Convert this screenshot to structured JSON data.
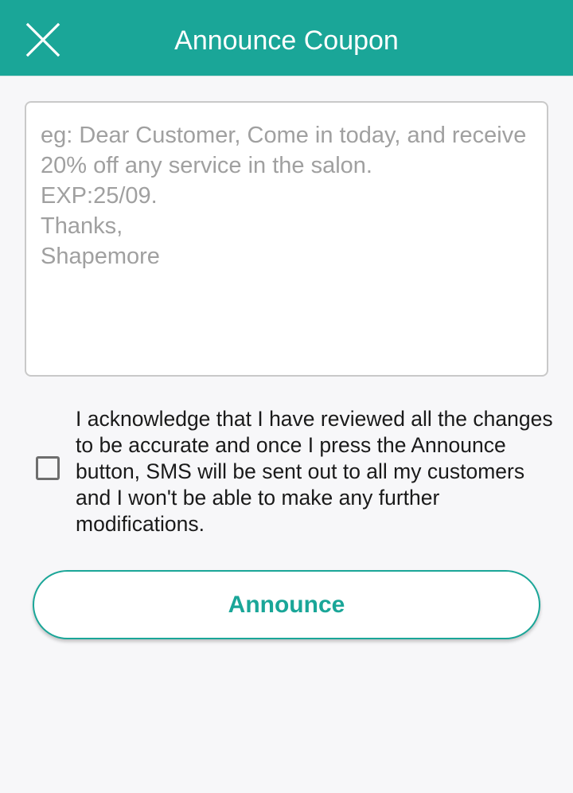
{
  "header": {
    "title": "Announce Coupon",
    "close_icon": "close-icon",
    "background_color": "#1aa698"
  },
  "message": {
    "value": "",
    "placeholder": "eg: Dear Customer, Come in today, and receive 20% off any service in the salon.\nEXP:25/09.\nThanks,\nShapemore"
  },
  "acknowledgement": {
    "checked": false,
    "text": "I acknowledge that I have reviewed all the changes to be accurate and once I press the Announce button, SMS will be sent out to all my customers and I won't be able to make any further modifications."
  },
  "announce_button": {
    "label": "Announce",
    "accent_color": "#1aa698"
  }
}
